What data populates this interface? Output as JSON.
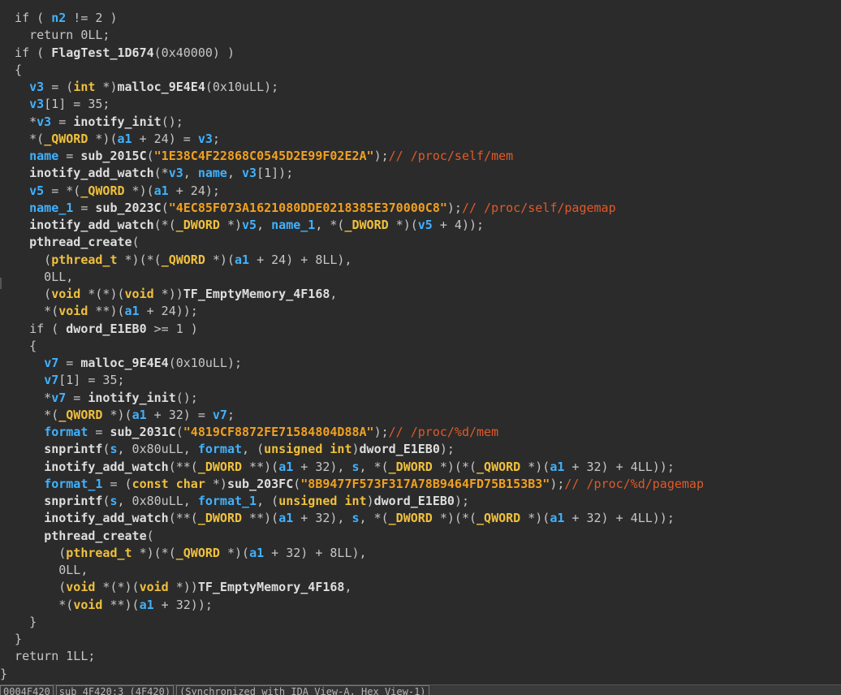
{
  "code_lines": [
    [
      [
        "kw",
        "  if ( "
      ],
      [
        "var",
        "n2"
      ],
      [
        "plain",
        " != 2 )"
      ]
    ],
    [
      [
        "kw",
        "    return 0LL;"
      ]
    ],
    [
      [
        "kw",
        "  if ( "
      ],
      [
        "fn",
        "FlagTest_1D674"
      ],
      [
        "plain",
        "(0x40000) )"
      ]
    ],
    [
      [
        "plain",
        "  {"
      ]
    ],
    [
      [
        "plain",
        "    "
      ],
      [
        "var",
        "v3"
      ],
      [
        "plain",
        " = ("
      ],
      [
        "type",
        "int"
      ],
      [
        "plain",
        " *)"
      ],
      [
        "fn",
        "malloc_9E4E4"
      ],
      [
        "plain",
        "(0x10uLL);"
      ]
    ],
    [
      [
        "plain",
        "    "
      ],
      [
        "var",
        "v3"
      ],
      [
        "plain",
        "[1] = 35;"
      ]
    ],
    [
      [
        "plain",
        "    *"
      ],
      [
        "var",
        "v3"
      ],
      [
        "plain",
        " = "
      ],
      [
        "fn",
        "inotify_init"
      ],
      [
        "plain",
        "();"
      ]
    ],
    [
      [
        "plain",
        "    *("
      ],
      [
        "type",
        "_QWORD"
      ],
      [
        "plain",
        " *)("
      ],
      [
        "var",
        "a1"
      ],
      [
        "plain",
        " + 24) = "
      ],
      [
        "var",
        "v3"
      ],
      [
        "plain",
        ";"
      ]
    ],
    [
      [
        "plain",
        "    "
      ],
      [
        "var",
        "name"
      ],
      [
        "plain",
        " = "
      ],
      [
        "fn",
        "sub_2015C"
      ],
      [
        "plain",
        "("
      ],
      [
        "str",
        "\"1E38C4F22868C0545D2E99F02E2A\""
      ],
      [
        "plain",
        ");"
      ],
      [
        "cmt",
        "// /proc/self/mem"
      ]
    ],
    [
      [
        "plain",
        "    "
      ],
      [
        "fn",
        "inotify_add_watch"
      ],
      [
        "plain",
        "(*"
      ],
      [
        "var",
        "v3"
      ],
      [
        "plain",
        ", "
      ],
      [
        "var",
        "name"
      ],
      [
        "plain",
        ", "
      ],
      [
        "var",
        "v3"
      ],
      [
        "plain",
        "[1]);"
      ]
    ],
    [
      [
        "plain",
        "    "
      ],
      [
        "var",
        "v5"
      ],
      [
        "plain",
        " = *("
      ],
      [
        "type",
        "_QWORD"
      ],
      [
        "plain",
        " *)("
      ],
      [
        "var",
        "a1"
      ],
      [
        "plain",
        " + 24);"
      ]
    ],
    [
      [
        "plain",
        "    "
      ],
      [
        "var",
        "name_1"
      ],
      [
        "plain",
        " = "
      ],
      [
        "fn",
        "sub_2023C"
      ],
      [
        "plain",
        "("
      ],
      [
        "str",
        "\"4EC85F073A1621080DDE0218385E370000C8\""
      ],
      [
        "plain",
        ");"
      ],
      [
        "cmt",
        "// /proc/self/pagemap"
      ]
    ],
    [
      [
        "plain",
        "    "
      ],
      [
        "fn",
        "inotify_add_watch"
      ],
      [
        "plain",
        "(*("
      ],
      [
        "type",
        "_DWORD"
      ],
      [
        "plain",
        " *)"
      ],
      [
        "var",
        "v5"
      ],
      [
        "plain",
        ", "
      ],
      [
        "var",
        "name_1"
      ],
      [
        "plain",
        ", *("
      ],
      [
        "type",
        "_DWORD"
      ],
      [
        "plain",
        " *)("
      ],
      [
        "var",
        "v5"
      ],
      [
        "plain",
        " + 4));"
      ]
    ],
    [
      [
        "plain",
        "    "
      ],
      [
        "fn",
        "pthread_create"
      ],
      [
        "plain",
        "("
      ]
    ],
    [
      [
        "plain",
        "      ("
      ],
      [
        "type",
        "pthread_t"
      ],
      [
        "plain",
        " *)(*("
      ],
      [
        "type",
        "_QWORD"
      ],
      [
        "plain",
        " *)("
      ],
      [
        "var",
        "a1"
      ],
      [
        "plain",
        " + 24) + 8LL),"
      ]
    ],
    [
      [
        "plain",
        "      0LL,"
      ]
    ],
    [
      [
        "plain",
        "      ("
      ],
      [
        "type",
        "void"
      ],
      [
        "plain",
        " *(*)("
      ],
      [
        "type",
        "void"
      ],
      [
        "plain",
        " *))"
      ],
      [
        "fn",
        "TF_EmptyMemory_4F168"
      ],
      [
        "plain",
        ","
      ]
    ],
    [
      [
        "plain",
        "      *("
      ],
      [
        "type",
        "void"
      ],
      [
        "plain",
        " **)("
      ],
      [
        "var",
        "a1"
      ],
      [
        "plain",
        " + 24));"
      ]
    ],
    [
      [
        "kw",
        "    if ( "
      ],
      [
        "fn",
        "dword_E1EB0"
      ],
      [
        "plain",
        " >= 1 )"
      ]
    ],
    [
      [
        "plain",
        "    {"
      ]
    ],
    [
      [
        "plain",
        "      "
      ],
      [
        "var",
        "v7"
      ],
      [
        "plain",
        " = "
      ],
      [
        "fn",
        "malloc_9E4E4"
      ],
      [
        "plain",
        "(0x10uLL);"
      ]
    ],
    [
      [
        "plain",
        "      "
      ],
      [
        "var",
        "v7"
      ],
      [
        "plain",
        "[1] = 35;"
      ]
    ],
    [
      [
        "plain",
        "      *"
      ],
      [
        "var",
        "v7"
      ],
      [
        "plain",
        " = "
      ],
      [
        "fn",
        "inotify_init"
      ],
      [
        "plain",
        "();"
      ]
    ],
    [
      [
        "plain",
        "      *("
      ],
      [
        "type",
        "_QWORD"
      ],
      [
        "plain",
        " *)("
      ],
      [
        "var",
        "a1"
      ],
      [
        "plain",
        " + 32) = "
      ],
      [
        "var",
        "v7"
      ],
      [
        "plain",
        ";"
      ]
    ],
    [
      [
        "plain",
        "      "
      ],
      [
        "var",
        "format"
      ],
      [
        "plain",
        " = "
      ],
      [
        "fn",
        "sub_2031C"
      ],
      [
        "plain",
        "("
      ],
      [
        "str",
        "\"4819CF8872FE71584804D88A\""
      ],
      [
        "plain",
        ");"
      ],
      [
        "cmt",
        "// /proc/%d/mem"
      ]
    ],
    [
      [
        "plain",
        "      "
      ],
      [
        "fn",
        "snprintf"
      ],
      [
        "plain",
        "("
      ],
      [
        "var",
        "s"
      ],
      [
        "plain",
        ", 0x80uLL, "
      ],
      [
        "var",
        "format"
      ],
      [
        "plain",
        ", ("
      ],
      [
        "type",
        "unsigned int"
      ],
      [
        "plain",
        ")"
      ],
      [
        "fn",
        "dword_E1EB0"
      ],
      [
        "plain",
        ");"
      ]
    ],
    [
      [
        "plain",
        "      "
      ],
      [
        "fn",
        "inotify_add_watch"
      ],
      [
        "plain",
        "(**("
      ],
      [
        "type",
        "_DWORD"
      ],
      [
        "plain",
        " **)("
      ],
      [
        "var",
        "a1"
      ],
      [
        "plain",
        " + 32), "
      ],
      [
        "var",
        "s"
      ],
      [
        "plain",
        ", *("
      ],
      [
        "type",
        "_DWORD"
      ],
      [
        "plain",
        " *)(*("
      ],
      [
        "type",
        "_QWORD"
      ],
      [
        "plain",
        " *)("
      ],
      [
        "var",
        "a1"
      ],
      [
        "plain",
        " + 32) + 4LL));"
      ]
    ],
    [
      [
        "plain",
        "      "
      ],
      [
        "var",
        "format_1"
      ],
      [
        "plain",
        " = ("
      ],
      [
        "type",
        "const char"
      ],
      [
        "plain",
        " *)"
      ],
      [
        "fn",
        "sub_203FC"
      ],
      [
        "plain",
        "("
      ],
      [
        "str",
        "\"8B9477F573F317A78B9464FD75B153B3\""
      ],
      [
        "plain",
        ");"
      ],
      [
        "cmt",
        "// /proc/%d/pagemap"
      ]
    ],
    [
      [
        "plain",
        "      "
      ],
      [
        "fn",
        "snprintf"
      ],
      [
        "plain",
        "("
      ],
      [
        "var",
        "s"
      ],
      [
        "plain",
        ", 0x80uLL, "
      ],
      [
        "var",
        "format_1"
      ],
      [
        "plain",
        ", ("
      ],
      [
        "type",
        "unsigned int"
      ],
      [
        "plain",
        ")"
      ],
      [
        "fn",
        "dword_E1EB0"
      ],
      [
        "plain",
        ");"
      ]
    ],
    [
      [
        "plain",
        "      "
      ],
      [
        "fn",
        "inotify_add_watch"
      ],
      [
        "plain",
        "(**("
      ],
      [
        "type",
        "_DWORD"
      ],
      [
        "plain",
        " **)("
      ],
      [
        "var",
        "a1"
      ],
      [
        "plain",
        " + 32), "
      ],
      [
        "var",
        "s"
      ],
      [
        "plain",
        ", *("
      ],
      [
        "type",
        "_DWORD"
      ],
      [
        "plain",
        " *)(*("
      ],
      [
        "type",
        "_QWORD"
      ],
      [
        "plain",
        " *)("
      ],
      [
        "var",
        "a1"
      ],
      [
        "plain",
        " + 32) + 4LL));"
      ]
    ],
    [
      [
        "plain",
        "      "
      ],
      [
        "fn",
        "pthread_create"
      ],
      [
        "plain",
        "("
      ]
    ],
    [
      [
        "plain",
        "        ("
      ],
      [
        "type",
        "pthread_t"
      ],
      [
        "plain",
        " *)(*("
      ],
      [
        "type",
        "_QWORD"
      ],
      [
        "plain",
        " *)("
      ],
      [
        "var",
        "a1"
      ],
      [
        "plain",
        " + 32) + 8LL),"
      ]
    ],
    [
      [
        "plain",
        "        0LL,"
      ]
    ],
    [
      [
        "plain",
        "        ("
      ],
      [
        "type",
        "void"
      ],
      [
        "plain",
        " *(*)("
      ],
      [
        "type",
        "void"
      ],
      [
        "plain",
        " *))"
      ],
      [
        "fn",
        "TF_EmptyMemory_4F168"
      ],
      [
        "plain",
        ","
      ]
    ],
    [
      [
        "plain",
        "        *("
      ],
      [
        "type",
        "void"
      ],
      [
        "plain",
        " **)("
      ],
      [
        "var",
        "a1"
      ],
      [
        "plain",
        " + 32));"
      ]
    ],
    [
      [
        "plain",
        "    }"
      ]
    ],
    [
      [
        "plain",
        "  }"
      ]
    ],
    [
      [
        "kw",
        "  return 1LL;"
      ]
    ],
    [
      [
        "plain",
        "}"
      ]
    ]
  ],
  "status": {
    "address": "0004F420",
    "location": "sub_4F420:3 (4F420)",
    "sync": "(Synchronized with IDA View-A, Hex View-1)"
  },
  "colors": {
    "background": "#2b2b2b",
    "type": "#f0c03c",
    "variable": "#3fb2ff",
    "string": "#f0a020",
    "comment": "#e05a2a"
  }
}
